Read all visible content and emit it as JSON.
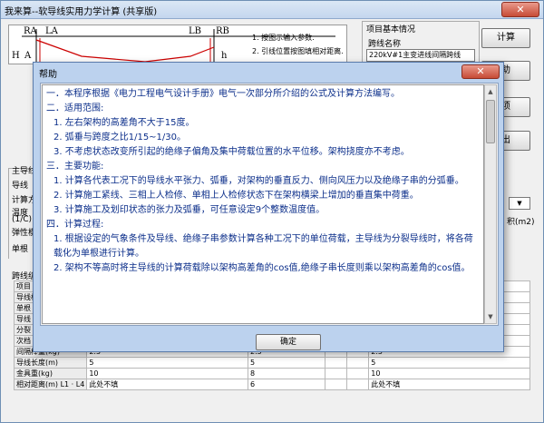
{
  "window": {
    "title": "我来算--软导线实用力学计算 (共享版)",
    "close_icon": "✕"
  },
  "diagram": {
    "label_ra": "RA",
    "label_la": "LA",
    "label_h": "H",
    "label_a": "A",
    "label_lb": "LB",
    "label_rb": "RB",
    "label_hb": "h",
    "steps": [
      "1. 按图示输入参数.",
      "2. 引线位置按图填相对距离."
    ]
  },
  "project": {
    "group_title": "项目基本情况",
    "line_name_label": "跨线名称",
    "line_name_value": "220kV#1主变进线间隔跨线"
  },
  "buttons": {
    "calculate": "计算",
    "help": "助",
    "item": "项",
    "exit": "出",
    "confirm": "确定"
  },
  "background_labels": [
    "主导线",
    "导线",
    "计算方",
    "温度",
    "(1/C)",
    "弹性模",
    "单根",
    "跨线级"
  ],
  "right_panel": {
    "unit_label": "积(m2)",
    "checkbox_mark": "✓"
  },
  "table": {
    "rows": [
      {
        "label": "项目",
        "cells": [
          "",
          "",
          "",
          "",
          ""
        ]
      },
      {
        "label": "导线根",
        "cells": [
          "",
          "",
          "",
          "",
          ""
        ]
      },
      {
        "label": "单根",
        "cells": [
          "",
          "",
          "",
          "",
          ""
        ]
      },
      {
        "label": "导线",
        "cells": [
          "",
          "",
          "",
          "",
          ""
        ]
      },
      {
        "label": "分裂",
        "cells": [
          "",
          "",
          "",
          "",
          ""
        ]
      },
      {
        "label": "次档",
        "cells": [
          "",
          "",
          "",
          "",
          ""
        ]
      },
      {
        "label": "间隔棒重(kg)",
        "cells": [
          "2.5",
          "2.5",
          "",
          "",
          "2.5"
        ]
      },
      {
        "label": "导线长度(m)",
        "cells": [
          "5",
          "5",
          "",
          "",
          "5"
        ]
      },
      {
        "label": "金具重(kg)",
        "cells": [
          "10",
          "8",
          "",
          "",
          "10"
        ]
      },
      {
        "label": "相对距离(m) L1 · L4",
        "cells": [
          "此处不填",
          "6",
          "",
          "",
          "此处不填"
        ]
      }
    ]
  },
  "help": {
    "title": "帮助",
    "close_icon": "✕",
    "paragraphs": [
      {
        "text": "一．本程序根据《电力工程电气设计手册》电气一次部分所介绍的公式及计算方法编写。",
        "indent": false
      },
      {
        "text": "二．适用范围:",
        "indent": false
      },
      {
        "text": "1. 左右架构的高差角不大于15度。",
        "indent": true
      },
      {
        "text": "2. 弧垂与跨度之比1/15~1/30。",
        "indent": true
      },
      {
        "text": "3. 不考虑状态改变所引起的绝缘子偏角及集中荷载位置的水平位移。架构挠度亦不考虑。",
        "indent": true
      },
      {
        "text": "三．主要功能:",
        "indent": false
      },
      {
        "text": "1. 计算各代表工况下的导线水平张力、弧垂，对架构的垂直反力、侧向风压力以及绝缘子串的分弧垂。",
        "indent": true
      },
      {
        "text": "2. 计算施工紧线、三相上人检修、单相上人检修状态下在架构横梁上增加的垂直集中荷重。",
        "indent": true
      },
      {
        "text": "3. 计算施工及划印状态的张力及弧垂，可任意设定9个整数温度值。",
        "indent": true
      },
      {
        "text": "四．计算过程:",
        "indent": false
      },
      {
        "text": "1. 根据设定的气象条件及导线、绝缘子串参数计算各种工况下的单位荷载，主导线为分裂导线时，将各荷载化为单根进行计算。",
        "indent": true
      },
      {
        "text": "2. 架构不等高时将主导线的计算荷载除以架构高差角的cos值,绝缘子串长度则乘以架构高差角的cos值。",
        "indent": true
      }
    ],
    "scroll_up_icon": "▲",
    "scroll_down_icon": "▼"
  }
}
